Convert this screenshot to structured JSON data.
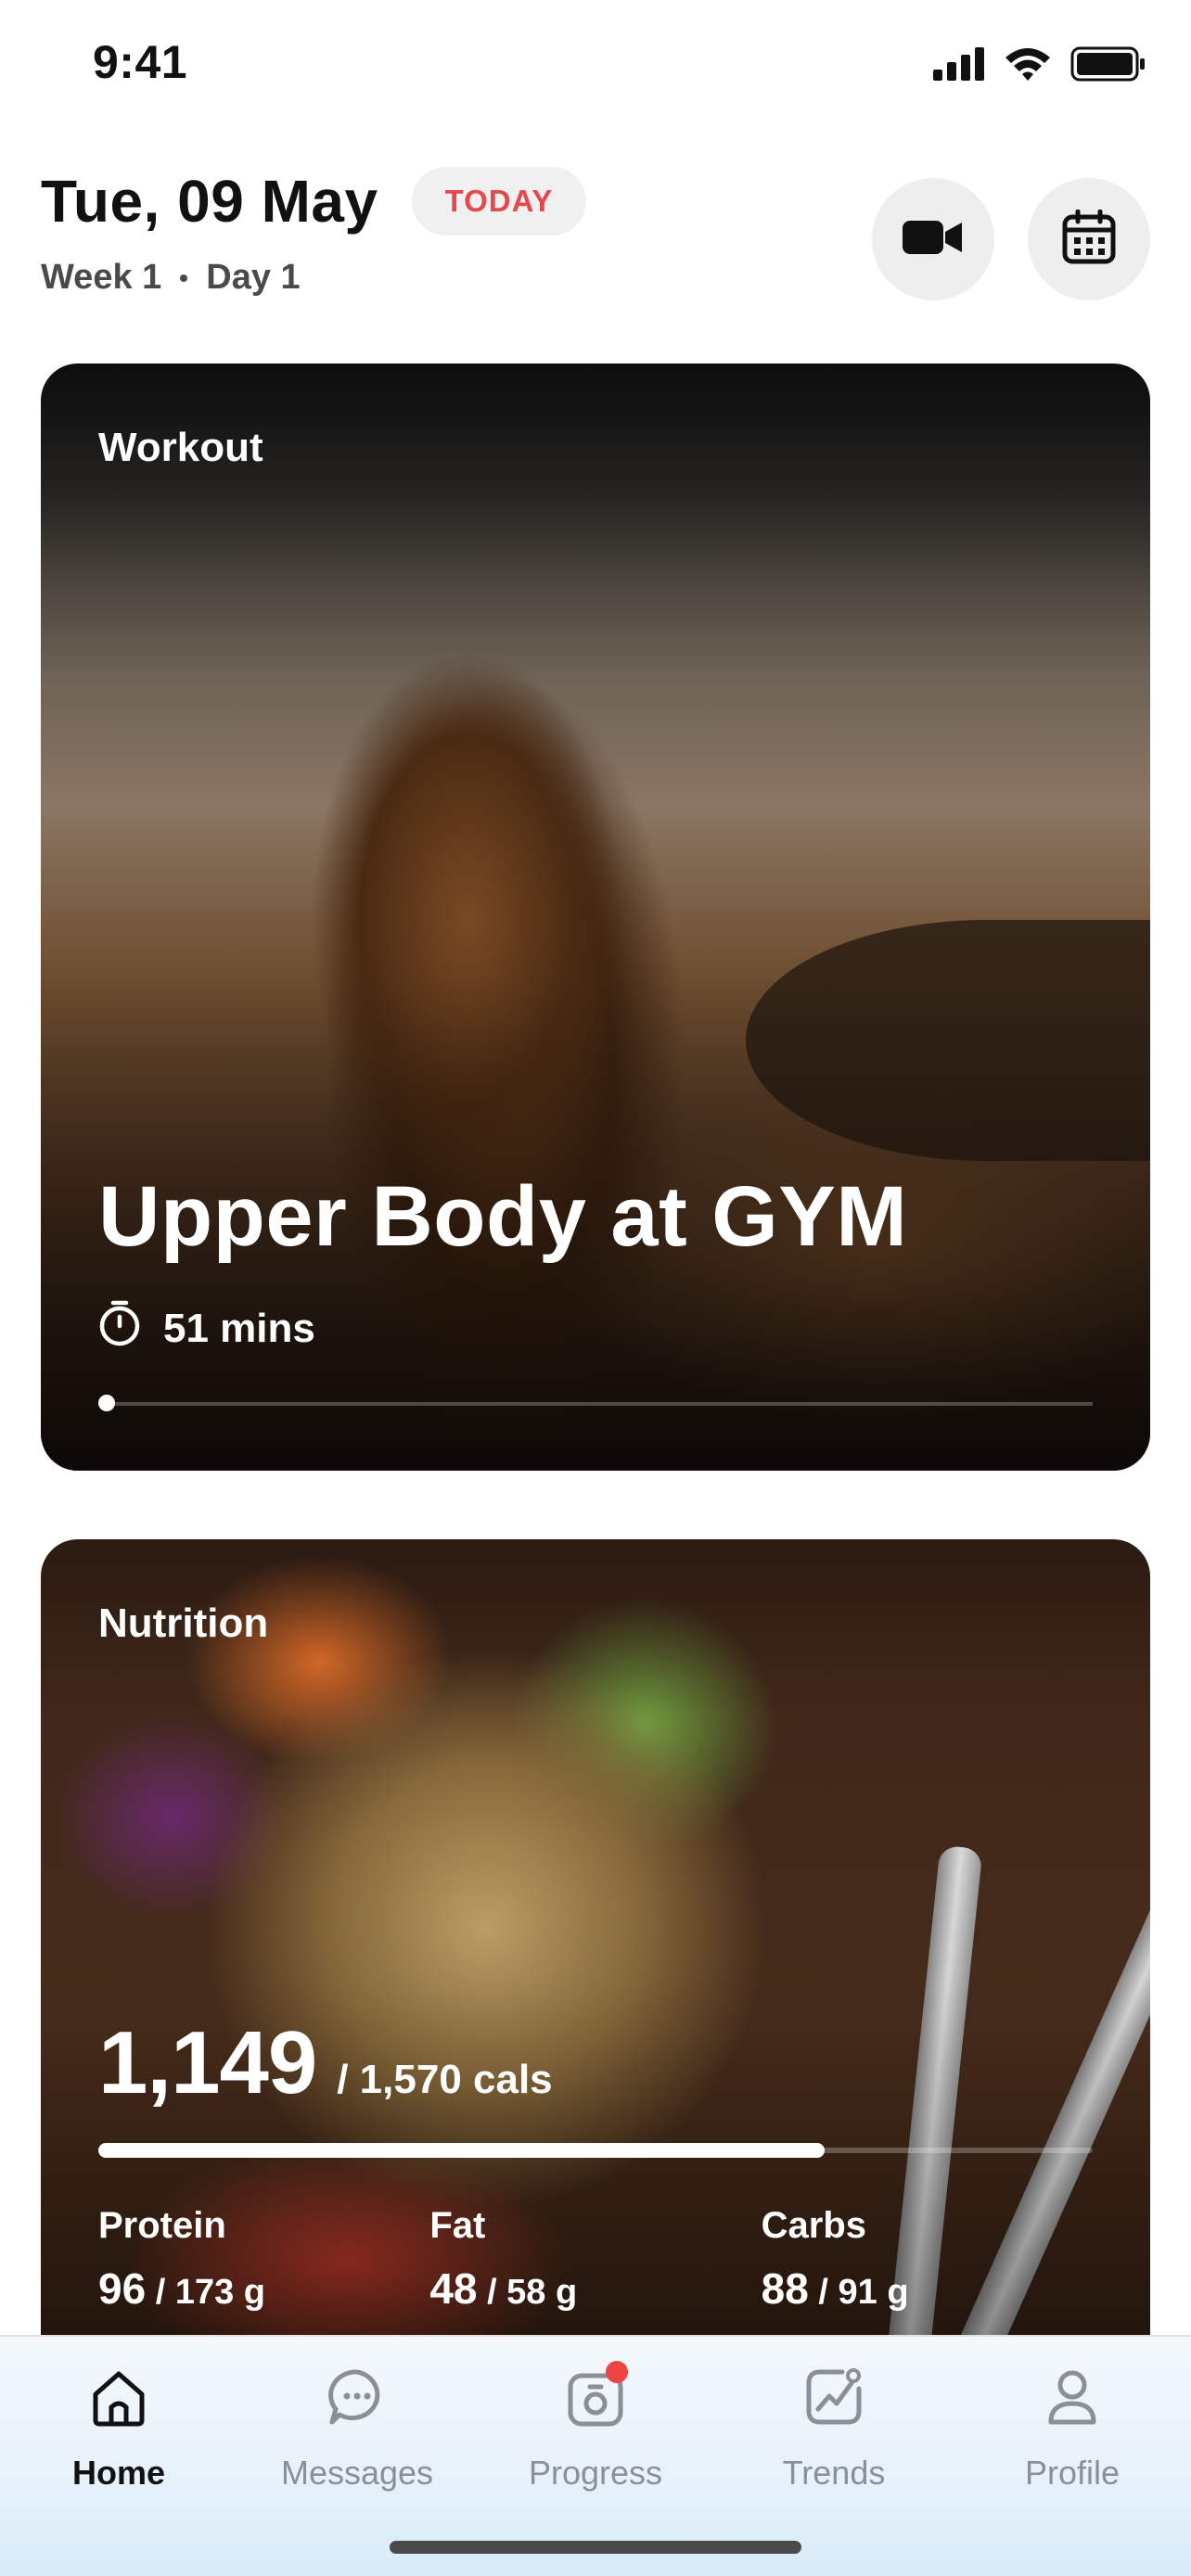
{
  "status_bar": {
    "time": "9:41",
    "icons": [
      "signal-icon",
      "wifi-icon",
      "battery-icon"
    ]
  },
  "header": {
    "date": "Tue, 09 May",
    "today_badge": "TODAY",
    "week": "Week 1",
    "day": "Day 1",
    "buttons": [
      "video-icon",
      "calendar-icon"
    ]
  },
  "workout": {
    "section_label": "Workout",
    "title": "Upper Body at GYM",
    "duration": "51 mins"
  },
  "nutrition": {
    "section_label": "Nutrition",
    "calories_consumed": "1,149",
    "calories_goal": "/ 1,570 cals",
    "calories_progress": 0.73,
    "macros": [
      {
        "label": "Protein",
        "current": "96",
        "goal": "/ 173 g"
      },
      {
        "label": "Fat",
        "current": "48",
        "goal": "/ 58 g"
      },
      {
        "label": "Carbs",
        "current": "88",
        "goal": "/ 91 g"
      }
    ]
  },
  "bottom_nav": {
    "items": [
      {
        "label": "Home",
        "icon": "home-icon",
        "active": true
      },
      {
        "label": "Messages",
        "icon": "chat-icon",
        "active": false
      },
      {
        "label": "Progress",
        "icon": "progress-camera-icon",
        "active": false,
        "has_badge": true
      },
      {
        "label": "Trends",
        "icon": "trends-icon",
        "active": false
      },
      {
        "label": "Profile",
        "icon": "person-icon",
        "active": false
      }
    ]
  },
  "colors": {
    "accent_red": "#e5484d",
    "badge_bg": "#f0f0f0",
    "nav_inactive": "#8b8f96",
    "notification_dot": "#ef4444"
  }
}
